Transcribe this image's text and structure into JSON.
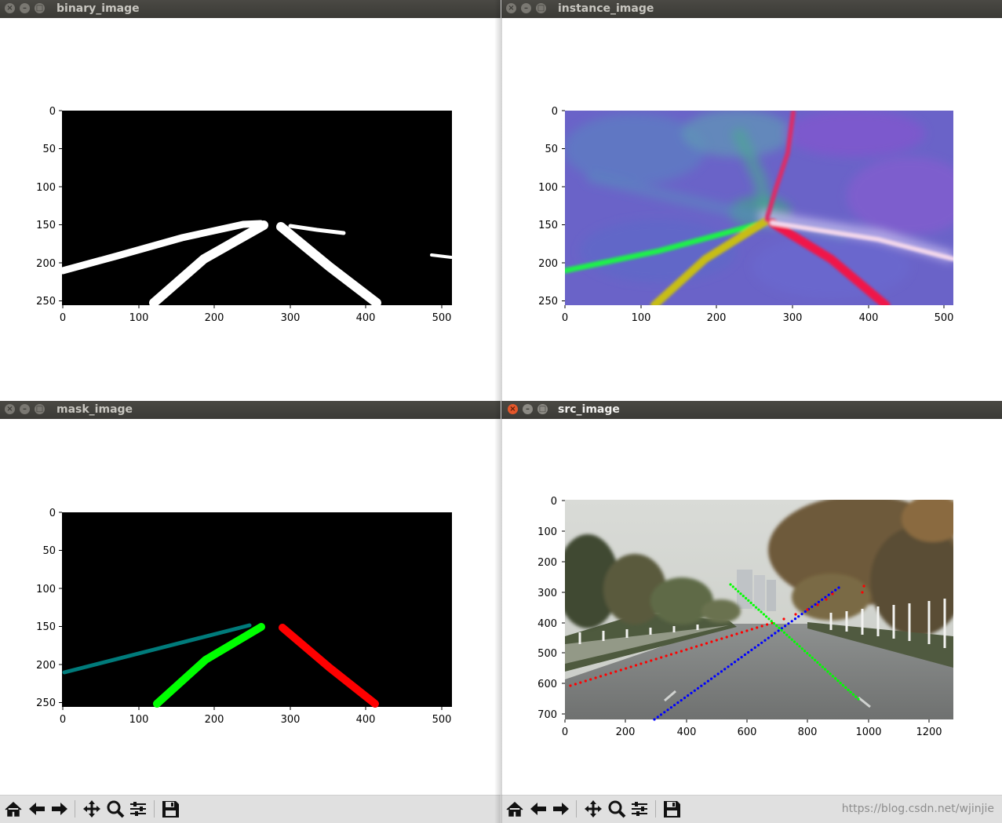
{
  "windows": {
    "binary": {
      "title": "binary_image"
    },
    "instance": {
      "title": "instance_image"
    },
    "mask": {
      "title": "mask_image"
    },
    "src": {
      "title": "src_image"
    }
  },
  "window_controls": {
    "close": "×",
    "minimize": "–",
    "maximize": "□"
  },
  "axes": {
    "small": {
      "x_ticks": [
        "0",
        "100",
        "200",
        "300",
        "400",
        "500"
      ],
      "y_ticks": [
        "0",
        "50",
        "100",
        "150",
        "200",
        "250"
      ],
      "xlim": [
        0,
        512
      ],
      "ylim": [
        256,
        0
      ]
    },
    "src": {
      "x_ticks": [
        "0",
        "200",
        "400",
        "600",
        "800",
        "1000",
        "1200"
      ],
      "y_ticks": [
        "0",
        "100",
        "200",
        "300",
        "400",
        "500",
        "600",
        "700"
      ],
      "xlim": [
        0,
        1280
      ],
      "ylim": [
        720,
        0
      ]
    }
  },
  "toolbar": {
    "buttons": [
      "home-icon",
      "back-icon",
      "forward-icon",
      "pan-icon",
      "zoom-icon",
      "configure-subplots-icon",
      "save-icon"
    ]
  },
  "colors": {
    "lane_green": "#00ff00",
    "lane_red": "#ff0000",
    "lane_teal": "#007b7b",
    "lane_blue": "#0000ff",
    "close_active": "#e4572b"
  },
  "watermark": "https://blog.csdn.net/wjinjie"
}
